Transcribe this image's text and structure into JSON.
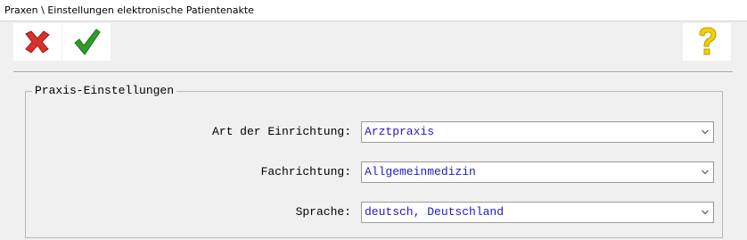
{
  "window": {
    "title": "Praxen \\ Einstellungen elektronische Patientenakte"
  },
  "toolbar": {
    "cancel_icon": "red-x-icon",
    "ok_icon": "green-check-icon",
    "help_icon": "question-mark-icon"
  },
  "group": {
    "title": "Praxis-Einstellungen",
    "fields": [
      {
        "label": "Art der Einrichtung:",
        "value": "Arztpraxis"
      },
      {
        "label": "Fachrichtung:",
        "value": "Allgemeinmedizin"
      },
      {
        "label": "Sprache:",
        "value": "deutsch, Deutschland"
      }
    ]
  },
  "colors": {
    "value_text": "#1a1acc",
    "cancel_red": "#d9302a",
    "ok_green": "#2e9e2a",
    "help_yellow": "#f5d000"
  }
}
